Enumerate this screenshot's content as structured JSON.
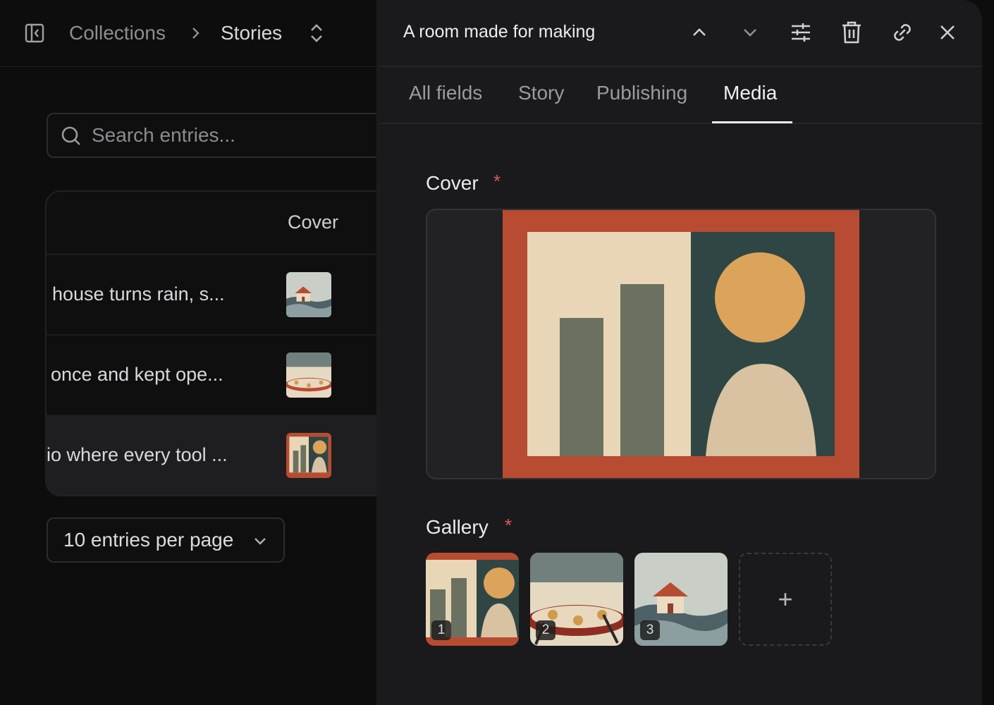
{
  "breadcrumb": {
    "parent": "Collections",
    "current": "Stories"
  },
  "search": {
    "placeholder": "Search entries...",
    "value": ""
  },
  "table": {
    "columns": [
      "Cover"
    ],
    "rows": [
      {
        "title": "house turns rain, s...",
        "cover": "house-on-waves",
        "selected": false
      },
      {
        "title": "once and kept ope...",
        "cover": "round-table",
        "selected": false
      },
      {
        "title": "io where every tool ...",
        "cover": "bars-and-sun",
        "selected": true
      }
    ]
  },
  "pagination": {
    "per_page_label": "10 entries per page"
  },
  "entry": {
    "title": "A room made for making",
    "actions": [
      "chevron-up-icon",
      "chevron-down-icon",
      "sliders-icon",
      "trash-icon",
      "link-icon",
      "close-icon"
    ]
  },
  "tabs": {
    "items": [
      {
        "label": "All fields",
        "active": false
      },
      {
        "label": "Story",
        "active": false
      },
      {
        "label": "Publishing",
        "active": false
      },
      {
        "label": "Media",
        "active": true
      }
    ]
  },
  "media": {
    "cover_label": "Cover",
    "cover_required": "*",
    "cover_image": "bars-and-sun",
    "gallery_label": "Gallery",
    "gallery_required": "*",
    "gallery": [
      {
        "index": "1",
        "image": "bars-and-sun"
      },
      {
        "index": "2",
        "image": "round-table"
      },
      {
        "index": "3",
        "image": "house-on-waves"
      }
    ],
    "add_label": "+"
  },
  "colors": {
    "terracotta": "#b84c32",
    "cream": "#e8d6b6",
    "olive": "#6b7160",
    "teal": "#2f4645",
    "mustard": "#dca35a",
    "sand": "#d8c2a2",
    "required": "#e0565a"
  }
}
